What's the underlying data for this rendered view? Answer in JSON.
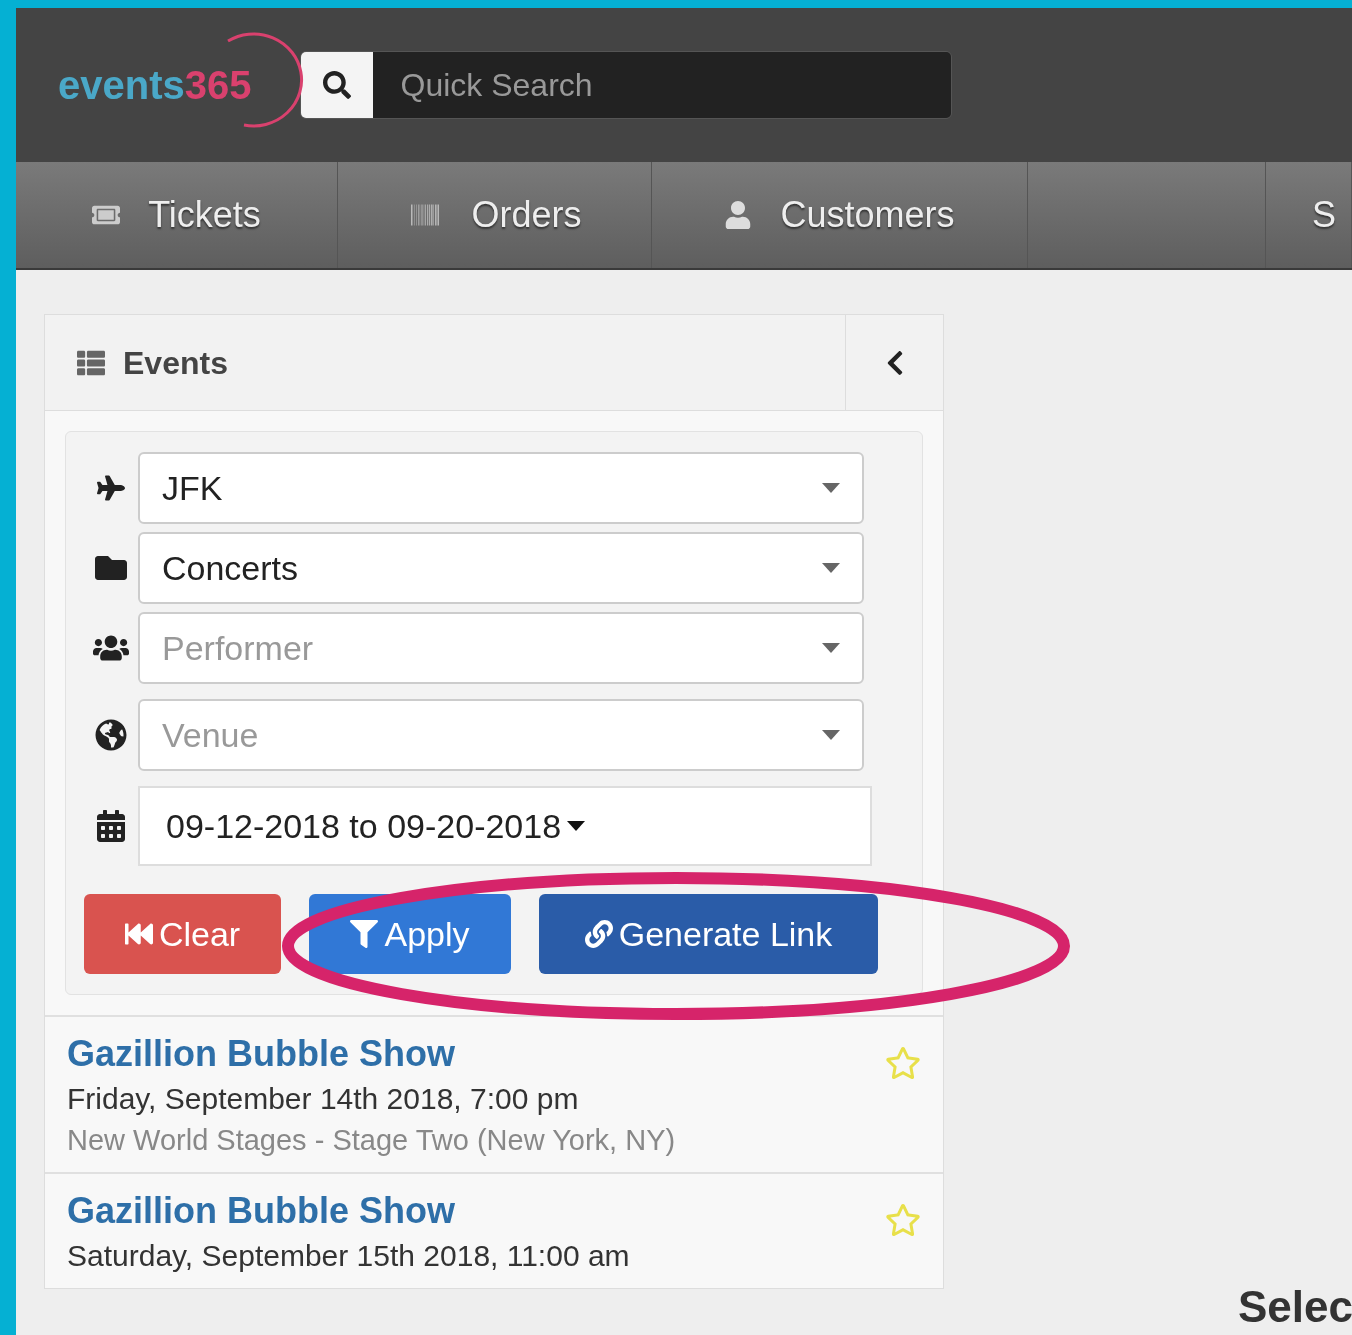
{
  "logo": {
    "word": "events",
    "number": "365"
  },
  "search": {
    "placeholder": "Quick Search"
  },
  "nav": [
    {
      "label": "Tickets",
      "kind": "tickets"
    },
    {
      "label": "Orders",
      "kind": "orders"
    },
    {
      "label": "Customers",
      "kind": "customers"
    },
    {
      "kind": "blank"
    },
    {
      "label": "S",
      "kind": "plain"
    }
  ],
  "panel": {
    "title": "Events",
    "filters": [
      {
        "kind": "airport",
        "value": "JFK"
      },
      {
        "kind": "category",
        "value": "Concerts"
      },
      {
        "kind": "performer",
        "placeholder": "Performer"
      },
      {
        "kind": "venue",
        "placeholder": "Venue"
      }
    ],
    "date_range": "09-12-2018 to 09-20-2018",
    "buttons": [
      {
        "label": "Clear",
        "kind": "clear"
      },
      {
        "label": "Apply",
        "kind": "apply"
      },
      {
        "label": "Generate Link",
        "kind": "link"
      }
    ],
    "events": [
      {
        "title": "Gazillion Bubble Show",
        "date": "Friday, September 14th 2018, 7:00 pm",
        "venue": "New World Stages - Stage Two (New York, NY)",
        "favorite": false
      },
      {
        "title": "Gazillion Bubble Show",
        "date": "Saturday, September 15th 2018, 11:00 am",
        "favorite": false
      }
    ]
  },
  "main_heading": "Selec"
}
